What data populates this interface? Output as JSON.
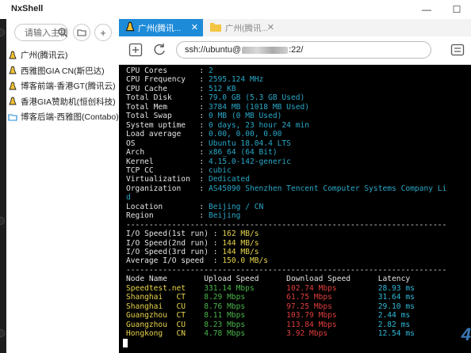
{
  "app": {
    "title": "NxShell",
    "minimize_glyph": "—",
    "maximize_glyph": "☐"
  },
  "sidebar": {
    "search_placeholder": "请输入主机",
    "folder_btn": "folder-icon",
    "add_btn": "+",
    "hosts": [
      {
        "label": "广州(腾讯云)",
        "icon": "linux-icon"
      },
      {
        "label": "西雅图GIA CN(斯巴达)",
        "icon": "linux-icon"
      },
      {
        "label": "博客前端-香港GT(腾讯云)",
        "icon": "linux-icon"
      },
      {
        "label": "香港GIA赞助机(恒创科技)",
        "icon": "linux-icon"
      },
      {
        "label": "博客后端-西雅图(Contabo)",
        "icon": "folder-icon"
      }
    ]
  },
  "tabs": [
    {
      "label": "广州(腾讯...",
      "close": "✕",
      "active": true
    },
    {
      "label": "广州(腾讯...",
      "close": "✕",
      "active": false
    }
  ],
  "toolbar": {
    "address_prefix": "ssh://ubuntu@",
    "address_suffix": ":22/"
  },
  "terminal": {
    "sysinfo": [
      {
        "k": "CPU Cores",
        "v": "2"
      },
      {
        "k": "CPU Frequency",
        "v": "2595.124 MHz"
      },
      {
        "k": "CPU Cache",
        "v": "512 KB"
      },
      {
        "k": "Total Disk",
        "v": "79.0 GB (5.3 GB Used)"
      },
      {
        "k": "Total Mem",
        "v": "3784 MB (1018 MB Used)"
      },
      {
        "k": "Total Swap",
        "v": "0 MB (0 MB Used)"
      },
      {
        "k": "System uptime",
        "v": "0 days, 23 hour 24 min"
      },
      {
        "k": "Load average",
        "v": "0.00, 0.00, 0.00"
      },
      {
        "k": "OS",
        "v": "Ubuntu 18.04.4 LTS"
      },
      {
        "k": "Arch",
        "v": "x86_64 (64 Bit)"
      },
      {
        "k": "Kernel",
        "v": "4.15.0-142-generic"
      },
      {
        "k": "TCP CC",
        "v": "cubic"
      },
      {
        "k": "Virtualization",
        "v": "Dedicated"
      },
      {
        "k": "Organization",
        "v": "AS45090 Shenzhen Tencent Computer Systems Company Li"
      }
    ],
    "wrap_tail": "d",
    "location": [
      {
        "k": "Location",
        "v": "Beijing / CN"
      },
      {
        "k": "Region",
        "v": "Beijing"
      }
    ],
    "separator": "----------------------------------------------------------------------",
    "io": [
      {
        "k": "I/O Speed(1st run)",
        "v": "162 MB/s"
      },
      {
        "k": "I/O Speed(2nd run)",
        "v": "144 MB/s"
      },
      {
        "k": "I/O Speed(3rd run)",
        "v": "144 MB/s"
      },
      {
        "k": "Average I/O speed",
        "v": "150.0 MB/s"
      }
    ],
    "speed_header": {
      "node": "Node Name",
      "up": "Upload Speed",
      "down": "Download Speed",
      "lat": "Latency"
    },
    "speed_rows": [
      {
        "node": "Speedtest.net",
        "isp": "",
        "up": "331.14 Mbps",
        "down": "102.74 Mbps",
        "lat": "28.93 ms"
      },
      {
        "node": "Shanghai",
        "isp": "CT",
        "up": "8.29 Mbps",
        "down": "61.75 Mbps",
        "lat": "31.64 ms"
      },
      {
        "node": "Shanghai",
        "isp": "CU",
        "up": "8.76 Mbps",
        "down": "97.25 Mbps",
        "lat": "29.10 ms"
      },
      {
        "node": "Guangzhou",
        "isp": "CT",
        "up": "8.11 Mbps",
        "down": "103.79 Mbps",
        "lat": "2.44 ms"
      },
      {
        "node": "Guangzhou",
        "isp": "CU",
        "up": "8.23 Mbps",
        "down": "113.84 Mbps",
        "lat": "2.82 ms"
      },
      {
        "node": "Hongkong",
        "isp": "CN",
        "up": "4.78 Mbps",
        "down": "3.92 Mbps",
        "lat": "12.54 ms"
      }
    ],
    "watermark": "4"
  },
  "colors": {
    "accent": "#1e8bd9",
    "terminal_bg": "#000000",
    "value": "#29a8c8",
    "yellow": "#e7d44a",
    "green": "#49b44a",
    "red": "#e03c3c"
  }
}
